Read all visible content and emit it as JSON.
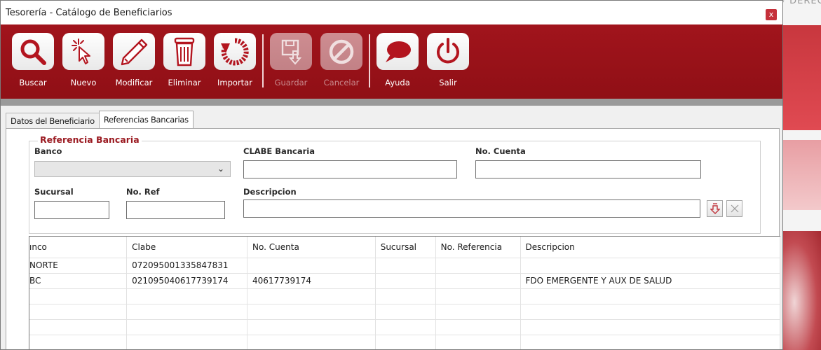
{
  "window": {
    "title": "Tesorería - Catálogo de Beneficiarios",
    "close_label": "x"
  },
  "background": {
    "top_text": "© DERECHOS RESERVADOS GLOBALMAX"
  },
  "toolbar": {
    "buttons": [
      {
        "label": "Buscar",
        "icon": "search-icon",
        "enabled": true
      },
      {
        "label": "Nuevo",
        "icon": "cursor-click-icon",
        "enabled": true
      },
      {
        "label": "Modificar",
        "icon": "pencil-icon",
        "enabled": true
      },
      {
        "label": "Eliminar",
        "icon": "trash-icon",
        "enabled": true
      },
      {
        "label": "Importar",
        "icon": "refresh-icon",
        "enabled": true
      },
      {
        "label": "Guardar",
        "icon": "save-icon",
        "enabled": false
      },
      {
        "label": "Cancelar",
        "icon": "cancel-icon",
        "enabled": false
      },
      {
        "label": "Ayuda",
        "icon": "speech-bubble-icon",
        "enabled": true
      },
      {
        "label": "Salir",
        "icon": "power-icon",
        "enabled": true
      }
    ]
  },
  "tabs": [
    {
      "label": "Datos del Beneficiario",
      "active": false
    },
    {
      "label": "Referencias Bancarias",
      "active": true
    }
  ],
  "form": {
    "group_title": "Referencia Bancaria",
    "banco_label": "Banco",
    "banco_value": "",
    "clabe_label": "CLABE Bancaria",
    "clabe_value": "",
    "cuenta_label": "No. Cuenta",
    "cuenta_value": "",
    "sucursal_label": "Sucursal",
    "sucursal_value": "",
    "noref_label": "No. Ref",
    "noref_value": "",
    "descripcion_label": "Descripcion",
    "descripcion_value": ""
  },
  "grid": {
    "columns": [
      "ınco",
      "Clabe",
      "No. Cuenta",
      "Sucursal",
      "No. Referencia",
      "Descripcion"
    ],
    "rows": [
      [
        "NORTE",
        "072095001335847831",
        "",
        "",
        "",
        ""
      ],
      [
        "BC",
        "021095040617739174",
        "40617739174",
        "",
        "",
        "FDO EMERGENTE Y AUX DE SALUD"
      ],
      [
        "",
        "",
        "",
        "",
        "",
        ""
      ],
      [
        "",
        "",
        "",
        "",
        "",
        ""
      ],
      [
        "",
        "",
        "",
        "",
        "",
        ""
      ],
      [
        "",
        "",
        "",
        "",
        "",
        ""
      ]
    ]
  },
  "colors": {
    "toolbar_red": "#9a1119",
    "label_red": "#9b1b22",
    "close_red": "#c5303a"
  }
}
